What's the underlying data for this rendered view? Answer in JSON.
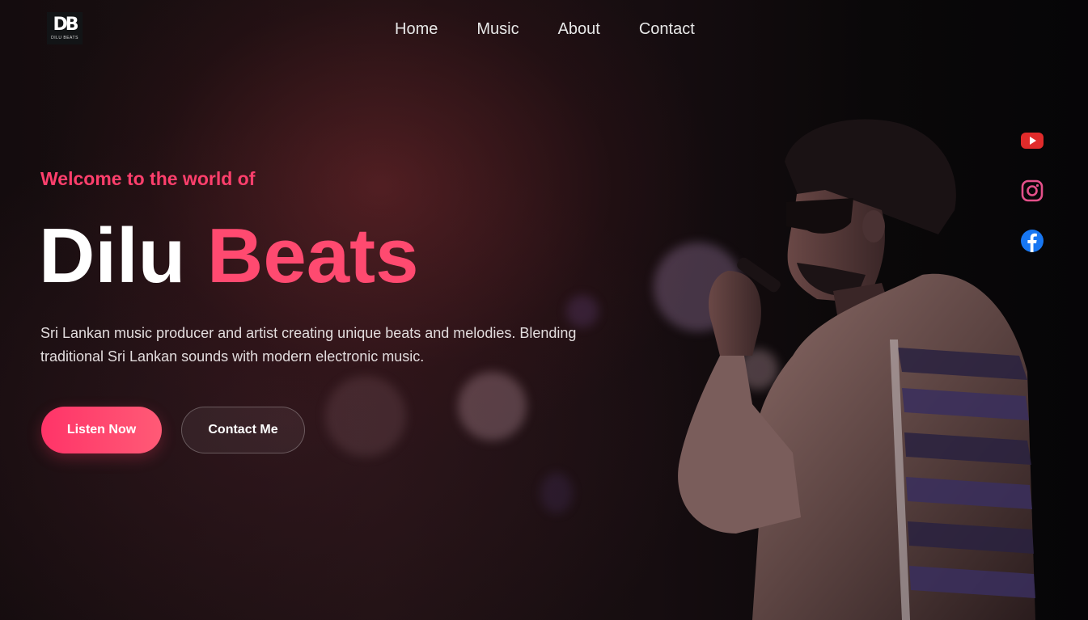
{
  "brand": {
    "logo_mark": "DB",
    "logo_text": "DILU BEATS"
  },
  "nav": {
    "items": [
      "Home",
      "Music",
      "About",
      "Contact"
    ]
  },
  "hero": {
    "welcome": "Welcome to the world of",
    "title_first": "Dilu",
    "title_second": "Beats",
    "description": "Sri Lankan music producer and artist creating unique beats and melodies. Blending traditional Sri Lankan sounds with modern electronic music.",
    "buttons": {
      "listen": "Listen Now",
      "contact": "Contact Me"
    }
  },
  "social": [
    {
      "icon": "youtube-icon",
      "color": "#e02b2b"
    },
    {
      "icon": "instagram-icon",
      "color": "#e4508a"
    },
    {
      "icon": "facebook-icon",
      "color": "#1877f2"
    }
  ],
  "colors": {
    "accent": "#ff3f6c",
    "background": "#0b0a0c"
  }
}
